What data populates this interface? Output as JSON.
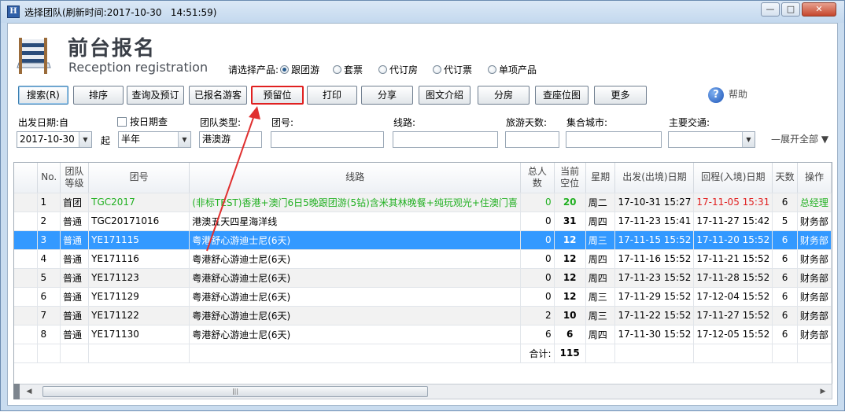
{
  "window": {
    "title": "选择团队(刷新时间:2017-10-30   14:51:59)",
    "icon_letter": "H",
    "controls": [
      "minimize-icon",
      "maximize-icon",
      "close-icon"
    ]
  },
  "header": {
    "title_cn": "前台报名",
    "title_en": "Reception registration",
    "product_label": "请选择产品:",
    "product_options": [
      {
        "label": "跟团游",
        "selected": true
      },
      {
        "label": "套票",
        "selected": false
      },
      {
        "label": "代订房",
        "selected": false
      },
      {
        "label": "代订票",
        "selected": false
      },
      {
        "label": "单项产品",
        "selected": false
      }
    ]
  },
  "toolbar": {
    "buttons": [
      "搜索(R)",
      "排序",
      "查询及预订",
      "已报名游客",
      "预留位",
      "打印",
      "分享",
      "图文介绍",
      "分房",
      "查座位图",
      "更多"
    ],
    "highlighted": "预留位",
    "help_label": "帮助"
  },
  "filters": {
    "depart_label": "出发日期:自",
    "by_day_label": "按日期查",
    "depart_value": "2017-10-30",
    "to_label": "起",
    "range_value": "半年",
    "team_type_label": "团队类型:",
    "team_type_value": "港澳游",
    "team_no_label": "团号:",
    "team_no_value": "",
    "route_label": "线路:",
    "route_value": "",
    "days_label": "旅游天数:",
    "days_value": "",
    "gather_label": "集合城市:",
    "gather_value": "",
    "transport_label": "主要交通:",
    "transport_value": "",
    "expand_label": "展开全部"
  },
  "table": {
    "columns": [
      "",
      "No.",
      "团队等级",
      "团号",
      "线路",
      "总人数",
      "当前空位",
      "星期",
      "出发(出境)日期",
      "回程(入境)日期",
      "天数",
      "操作"
    ],
    "rows": [
      {
        "no": "1",
        "level": "首团",
        "code": "TGC2017",
        "line": "(非标TEST)香港+澳门6日5晚跟团游(5钻)含米其林晚餐+纯玩观光+住澳门喜",
        "total": "0",
        "vacancy": "20",
        "weekday": "周二",
        "depart": "17-10-31 15:27",
        "return": "17-11-05 15:31",
        "days": "6",
        "op": "总经理"
      },
      {
        "no": "2",
        "level": "普通",
        "code": "TGC20171016",
        "line": "港澳五天四星海洋线",
        "total": "0",
        "vacancy": "31",
        "weekday": "周四",
        "depart": "17-11-23 15:41",
        "return": "17-11-27 15:42",
        "days": "5",
        "op": "财务部"
      },
      {
        "no": "3",
        "level": "普通",
        "code": "YE171115",
        "line": "粤港舒心游迪士尼(6天)",
        "total": "0",
        "vacancy": "12",
        "weekday": "周三",
        "depart": "17-11-15 15:52",
        "return": "17-11-20 15:52",
        "days": "6",
        "op": "财务部"
      },
      {
        "no": "4",
        "level": "普通",
        "code": "YE171116",
        "line": "粤港舒心游迪士尼(6天)",
        "total": "0",
        "vacancy": "12",
        "weekday": "周四",
        "depart": "17-11-16 15:52",
        "return": "17-11-21 15:52",
        "days": "6",
        "op": "财务部"
      },
      {
        "no": "5",
        "level": "普通",
        "code": "YE171123",
        "line": "粤港舒心游迪士尼(6天)",
        "total": "0",
        "vacancy": "12",
        "weekday": "周四",
        "depart": "17-11-23 15:52",
        "return": "17-11-28 15:52",
        "days": "6",
        "op": "财务部"
      },
      {
        "no": "6",
        "level": "普通",
        "code": "YE171129",
        "line": "粤港舒心游迪士尼(6天)",
        "total": "0",
        "vacancy": "12",
        "weekday": "周三",
        "depart": "17-11-29 15:52",
        "return": "17-12-04 15:52",
        "days": "6",
        "op": "财务部"
      },
      {
        "no": "7",
        "level": "普通",
        "code": "YE171122",
        "line": "粤港舒心游迪士尼(6天)",
        "total": "2",
        "vacancy": "10",
        "weekday": "周三",
        "depart": "17-11-22 15:52",
        "return": "17-11-27 15:52",
        "days": "6",
        "op": "财务部"
      },
      {
        "no": "8",
        "level": "普通",
        "code": "YE171130",
        "line": "粤港舒心游迪士尼(6天)",
        "total": "6",
        "vacancy": "6",
        "weekday": "周四",
        "depart": "17-11-30 15:52",
        "return": "17-12-05 15:52",
        "days": "6",
        "op": "财务部"
      }
    ],
    "selected_row": "3",
    "total_label": "合计:",
    "total_vacancy": "115"
  },
  "colors": {
    "selection": "#3399ff",
    "highlight_border": "#e02020",
    "green_text": "#22b022",
    "red_text": "#e02020",
    "arrow": "#e03030"
  }
}
